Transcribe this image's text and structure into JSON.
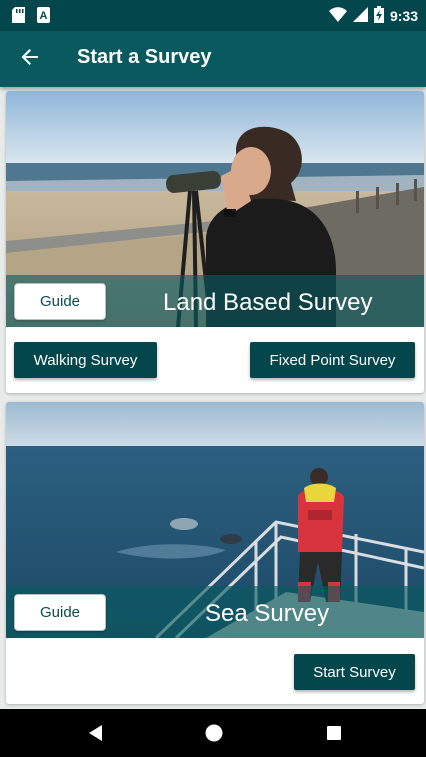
{
  "status_bar": {
    "time": "9:33",
    "icons": [
      "sd-card-icon",
      "a-notification-icon",
      "wifi-icon",
      "cellular-signal-icon",
      "battery-charging-icon"
    ]
  },
  "app_bar": {
    "title": "Start a Survey",
    "back_icon": "back-arrow-icon"
  },
  "cards": [
    {
      "title": "Land Based Survey",
      "guide_label": "Guide",
      "actions": [
        "Walking Survey",
        "Fixed Point Survey"
      ]
    },
    {
      "title": "Sea Survey",
      "guide_label": "Guide",
      "actions": [
        "Start Survey"
      ]
    }
  ],
  "navigation": {
    "back_icon": "nav-back-icon",
    "home_icon": "nav-home-icon",
    "recents_icon": "nav-recents-icon"
  },
  "colors": {
    "primary_dark": "#03464b",
    "primary": "#085a5f",
    "button": "#03464b",
    "background": "#e9ebeb"
  }
}
